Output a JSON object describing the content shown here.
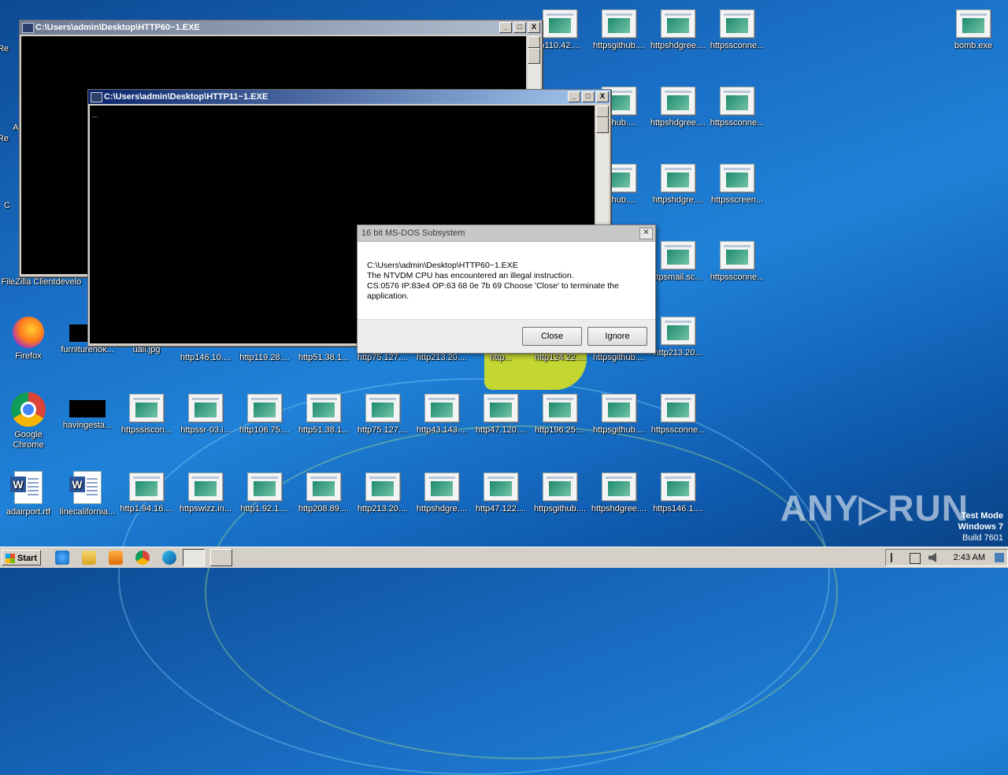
{
  "desktop": {
    "top_row": [
      "p110.42....",
      "httpsgithub....",
      "httpshdgree....",
      "httpssconne...",
      "bomb.exe"
    ],
    "row2": [
      "github....",
      "httpshdgree....",
      "httpssconne..."
    ],
    "row3": [
      "github....",
      "httpshdgre....",
      "httpsscreen..."
    ],
    "row4": [
      "ttpsmail.sc...",
      "httpssconne..."
    ],
    "left_partial": [
      "Re",
      "A",
      "Re",
      "C",
      "FileZilla Client",
      "develo"
    ],
    "row5": [
      "Firefox",
      "furniturenok...",
      "uall.jpg",
      "http146.10....",
      "http119.28....",
      "http51.38.1...",
      "http75.127....",
      "http213.20....",
      "http...",
      "http124.22....",
      "httpsgithub....",
      "http213.20..."
    ],
    "row6": [
      "Google Chrome",
      "havingesta...",
      "httpssiscon...",
      "httpssr-03.i...",
      "http106.75....",
      "http51.38.1...",
      "http75.127....",
      "http43.143....",
      "http47.120....",
      "http196.25....",
      "httpsgithub....",
      "httpssconne..."
    ],
    "row7": [
      "adairport.rtf",
      "linecalifornia...",
      "http1.94.16....",
      "httpswizz.in...",
      "http1.92.1....",
      "http208.89....",
      "http213.20....",
      "httpshdgre....",
      "http47.122....",
      "httpsgithub....",
      "httpshdgree....",
      "https146.1...."
    ]
  },
  "windows": {
    "back_title": "C:\\Users\\admin\\Desktop\\HTTP60~1.EXE",
    "front_title": "C:\\Users\\admin\\Desktop\\HTTP11~1.EXE",
    "cursor": "_",
    "minimize": "_",
    "maximize": "□",
    "close": "X"
  },
  "dialog": {
    "title": "16 bit MS-DOS Subsystem",
    "close_glyph": "✕",
    "line1": "C:\\Users\\admin\\Desktop\\HTTP60~1.EXE",
    "line2": "The NTVDM CPU has encountered an illegal instruction.",
    "line3": "CS:0576 IP:83e4 OP:63 68 0e 7b 69 Choose 'Close' to terminate the application.",
    "close_button": "Close",
    "ignore_button": "Ignore"
  },
  "taskbar": {
    "start_label": "Start",
    "clock": "2:43 AM"
  },
  "overlay": {
    "watermark": "ANY▷RUN",
    "test_mode": "Test Mode",
    "os": "Windows 7",
    "build": "Build 7601"
  }
}
